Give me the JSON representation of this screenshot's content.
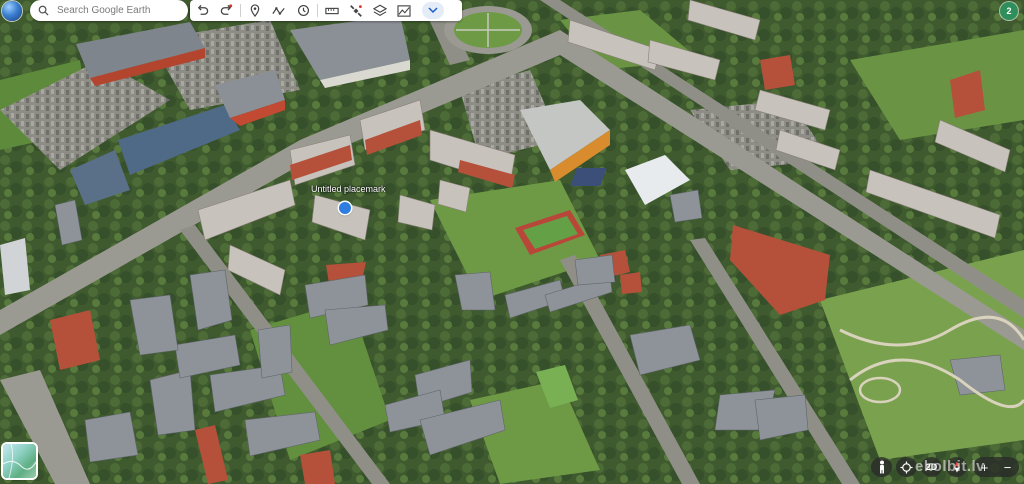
{
  "search": {
    "placeholder": "Search Google Earth"
  },
  "toolbar": {
    "tools": [
      "undo-icon",
      "redo-icon",
      "pin-icon",
      "path-icon",
      "clock-icon",
      "ruler-icon",
      "satellite-icon",
      "layers-icon",
      "elevation-icon",
      "chevron-down-icon"
    ]
  },
  "user": {
    "avatar_initial": "2"
  },
  "placemark": {
    "label": "Untitled placemark"
  },
  "controls": {
    "view_mode": "2D",
    "zoom_in": "+",
    "zoom_out": "−"
  },
  "watermark": {
    "text": "ekolbit.lv"
  },
  "colors": {
    "accent": "#2f7de1",
    "avatar": "#2f8f5b"
  }
}
